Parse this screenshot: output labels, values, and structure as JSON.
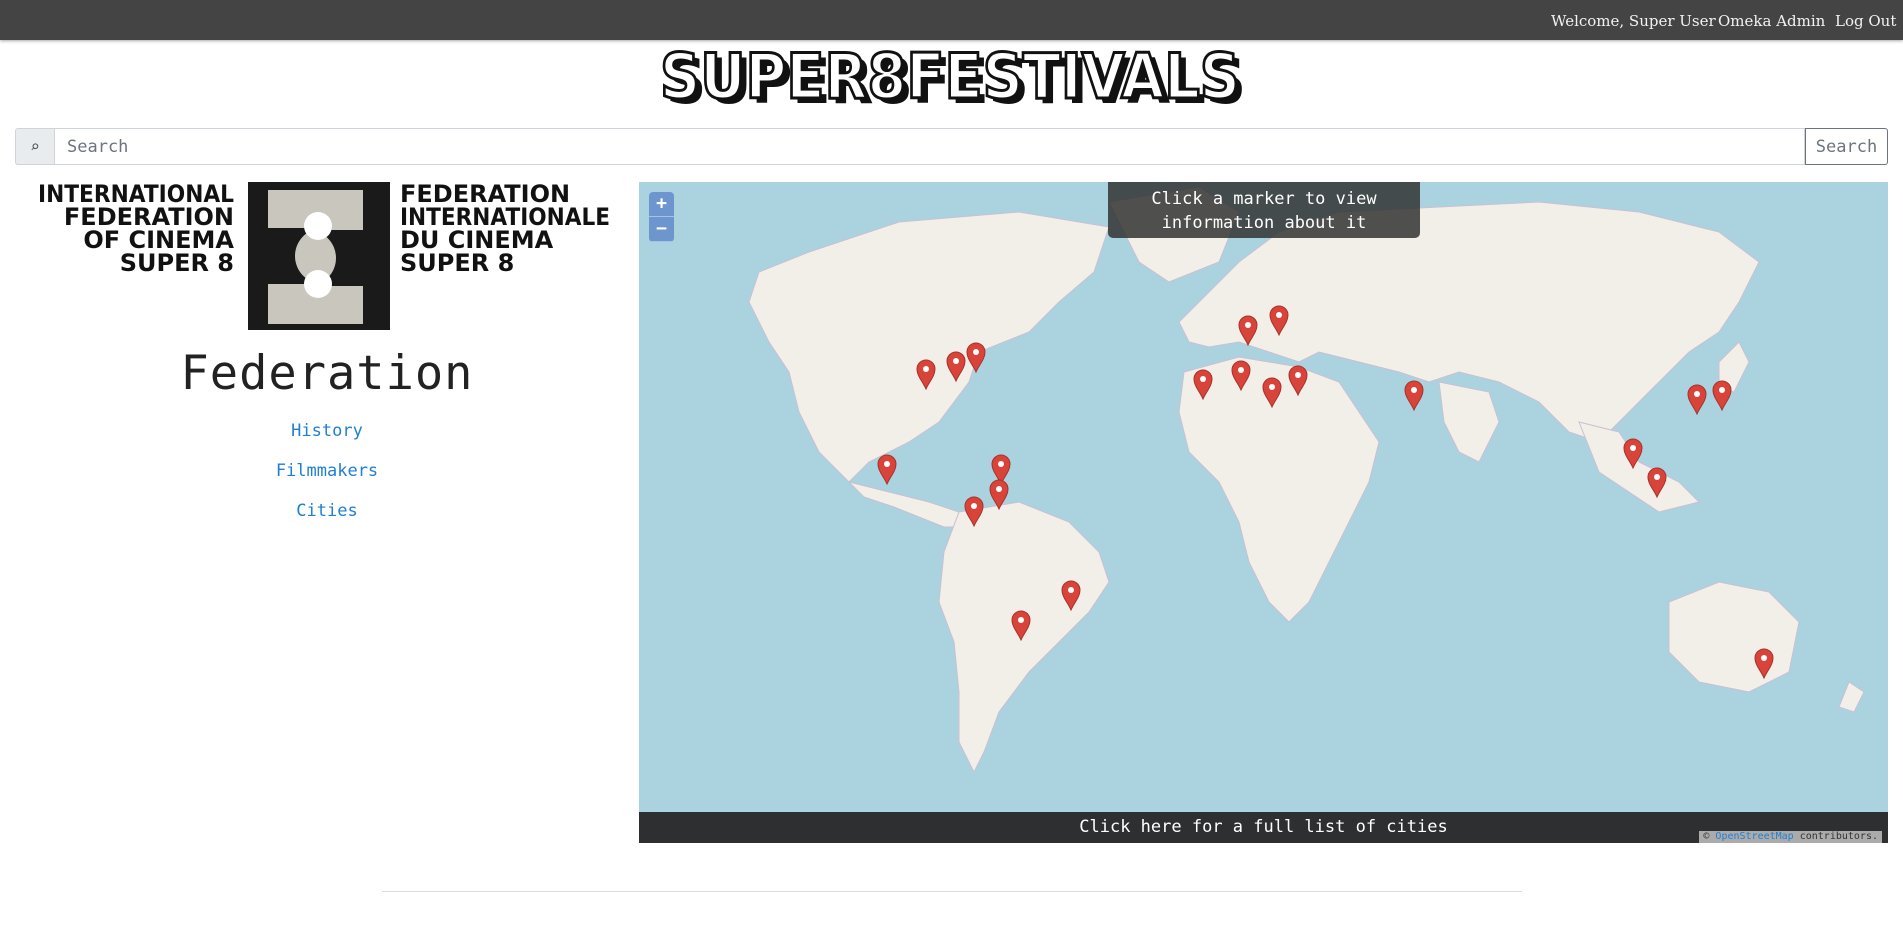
{
  "topbar": {
    "welcome": "Welcome, Super User",
    "admin": "Omeka Admin",
    "logout": "Log Out"
  },
  "brand": {
    "logo_text": "SUPER8FESTIVALS"
  },
  "search": {
    "icon": "search-icon",
    "placeholder": "Search",
    "button_label": "Search"
  },
  "federation": {
    "logo_left": [
      "INTERNATIONAL",
      "FEDERATION",
      "OF CINEMA",
      "SUPER 8"
    ],
    "logo_right": [
      "FEDERATION",
      "INTERNATIONALE",
      "DU CINEMA",
      "SUPER 8"
    ],
    "title": "Federation",
    "nav": [
      "History",
      "Filmmakers",
      "Cities"
    ],
    "link_color": "#1f7fd3"
  },
  "map": {
    "hint": "Click a marker to view information about it",
    "zoom_in": "+",
    "zoom_out": "−",
    "full_list": "Click here for a full list of cities",
    "attribution_prefix": "© ",
    "attribution_link": "OpenStreetMap",
    "attribution_suffix": " contributors.",
    "ocean_color": "#aad3df",
    "land_color": "#f2efe9",
    "marker_color": "#d9443a",
    "marker_icon": "map-marker-icon",
    "marker_count": 24
  }
}
